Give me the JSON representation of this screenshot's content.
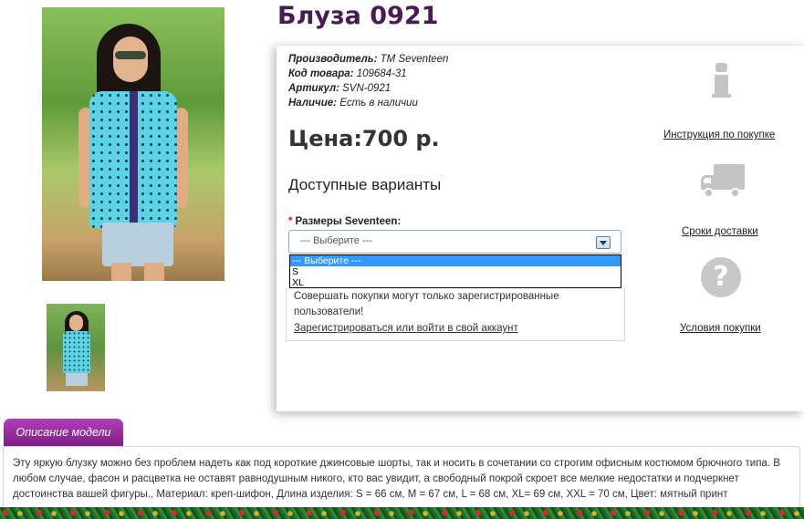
{
  "product": {
    "title": "Блуза 0921",
    "meta": [
      {
        "label": "Производитель:",
        "value": "TM Seventeen"
      },
      {
        "label": "Код товара:",
        "value": "109684-31"
      },
      {
        "label": "Артикул:",
        "value": "SVN-0921"
      },
      {
        "label": "Наличие:",
        "value": "Есть в наличии"
      }
    ],
    "price": "Цена:700 р."
  },
  "variants": {
    "heading": "Доступные варианты",
    "required_mark": "*",
    "size_label": "Размеры Seventeen:",
    "select_value": "--- Выберите ---",
    "options": [
      "--- Выберите ---",
      "S",
      "XL"
    ]
  },
  "notice": {
    "text": "Совершать покупки могут только зарегистрированные пользователи!",
    "link": "Зарегистрироваться или войти в свой аккаунт"
  },
  "side_links": {
    "instructions": "Инструкция по покупке",
    "delivery": "Сроки доставки",
    "terms": "Условия покупки",
    "help_glyph": "?"
  },
  "description": {
    "tab_label": "Описание модели",
    "text": "Эту яркую блузку можно без проблем надеть как под короткие джинсовые шорты, так и носить в сочетании со строгим офисным костюмом брючного типа. В любом случае, фасон и расцветка не оставят равнодушным никого, кто вас увидит, а свободный покрой скроет все мелкие недостатки и подчеркнет достоинства вашей фигуры., Материал: креп-шифон, Длина изделия: S = 66 см, M = 67 см, L = 68 см, XL= 69 см, XXL = 70 см, Цвет: мятный принт"
  },
  "colors": {
    "title": "#4a1a56",
    "tab": "#9a2aa2",
    "select_highlight": "#3399ff",
    "icons": "#c4c4c4"
  },
  "icons": [
    "info-icon",
    "truck-icon",
    "question-icon",
    "dropdown-arrow-icon"
  ]
}
